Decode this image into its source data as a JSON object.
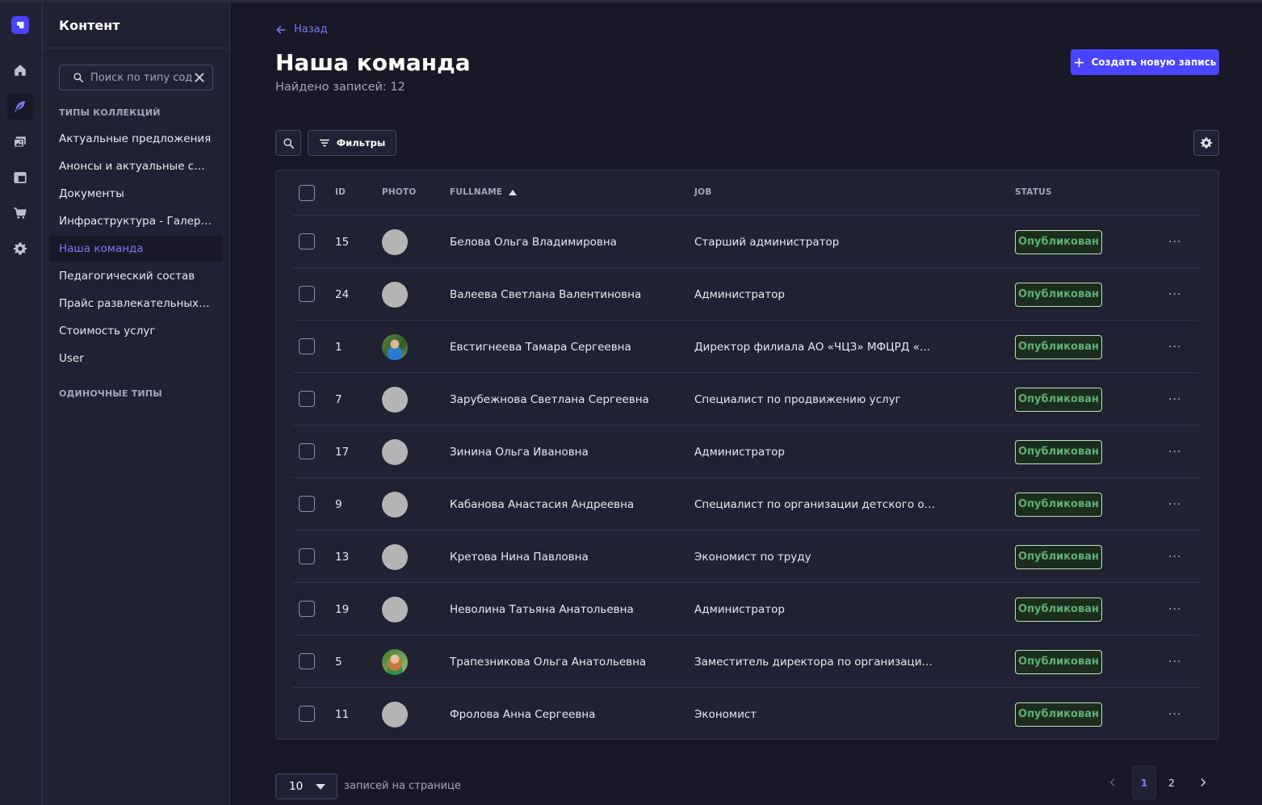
{
  "colors": {
    "accent": "#4945ff",
    "accent_text": "#7b79ff",
    "published": "#5cb176"
  },
  "rail": {
    "items": [
      {
        "name": "home-icon",
        "active": false
      },
      {
        "name": "feather-icon",
        "active": true
      },
      {
        "name": "media-library-icon",
        "active": false
      },
      {
        "name": "layout-icon",
        "active": false
      },
      {
        "name": "cart-icon",
        "active": false
      },
      {
        "name": "gear-icon",
        "active": false
      }
    ]
  },
  "sidebar": {
    "title": "Контент",
    "search_placeholder": "Поиск по типу содержимого",
    "collection_types_label": "ТИПЫ КОЛЛЕКЦИЙ",
    "single_types_label": "ОДИНОЧНЫЕ ТИПЫ",
    "items": [
      {
        "label": "Актуальные предложения"
      },
      {
        "label": "Анонсы и актуальные смены"
      },
      {
        "label": "Документы"
      },
      {
        "label": "Инфраструктура - Галерея"
      },
      {
        "label": "Наша команда"
      },
      {
        "label": "Педагогический состав"
      },
      {
        "label": "Прайс развлекательных программ"
      },
      {
        "label": "Стоимость услуг"
      },
      {
        "label": "User"
      }
    ]
  },
  "header": {
    "back_label": "Назад",
    "title": "Наша команда",
    "subtitle": "Найдено записей: 12",
    "create_label": "Создать новую запись"
  },
  "toolbar": {
    "filters_label": "Фильтры"
  },
  "table": {
    "columns": {
      "id": "ID",
      "photo": "PHOTO",
      "fullname": "FULLNAME",
      "job": "JOB",
      "status": "STATUS"
    },
    "rows": [
      {
        "id": "15",
        "photo": "placeholder",
        "fullname": "Белова Ольга Владимировна",
        "job": "Старший администратор",
        "status": "Опубликован"
      },
      {
        "id": "24",
        "photo": "placeholder",
        "fullname": "Валеева Светлана Валентиновна",
        "job": "Администратор",
        "status": "Опубликован"
      },
      {
        "id": "1",
        "photo": "photo",
        "fullname": "Евстигнеева Тамара Сергеевна",
        "job": "Директор филиала АО «ЧЦЗ» МФЦРД «Лес…",
        "status": "Опубликован"
      },
      {
        "id": "7",
        "photo": "placeholder",
        "fullname": "Зарубежнова Светлана Сергеевна",
        "job": "Специалист по продвижению услуг",
        "status": "Опубликован"
      },
      {
        "id": "17",
        "photo": "placeholder",
        "fullname": "Зинина Ольга Ивановна",
        "job": "Администратор",
        "status": "Опубликован"
      },
      {
        "id": "9",
        "photo": "placeholder",
        "fullname": "Кабанова Анастасия Андреевна",
        "job": "Специалист по организации детского отдыха",
        "status": "Опубликован"
      },
      {
        "id": "13",
        "photo": "placeholder",
        "fullname": "Кретова Нина Павловна",
        "job": "Экономист по труду",
        "status": "Опубликован"
      },
      {
        "id": "19",
        "photo": "placeholder",
        "fullname": "Неволина Татьяна Анатольевна",
        "job": "Администратор",
        "status": "Опубликован"
      },
      {
        "id": "5",
        "photo": "photo2",
        "fullname": "Трапезникова Ольга Анатольевна",
        "job": "Заместитель директора по организационны…",
        "status": "Опубликован"
      },
      {
        "id": "11",
        "photo": "placeholder",
        "fullname": "Фролова Анна Сергеевна",
        "job": "Экономист",
        "status": "Опубликован"
      }
    ]
  },
  "footer": {
    "per_page_value": "10",
    "per_page_label": "записей на странице",
    "pages": [
      "1",
      "2"
    ],
    "current_page": "1"
  }
}
